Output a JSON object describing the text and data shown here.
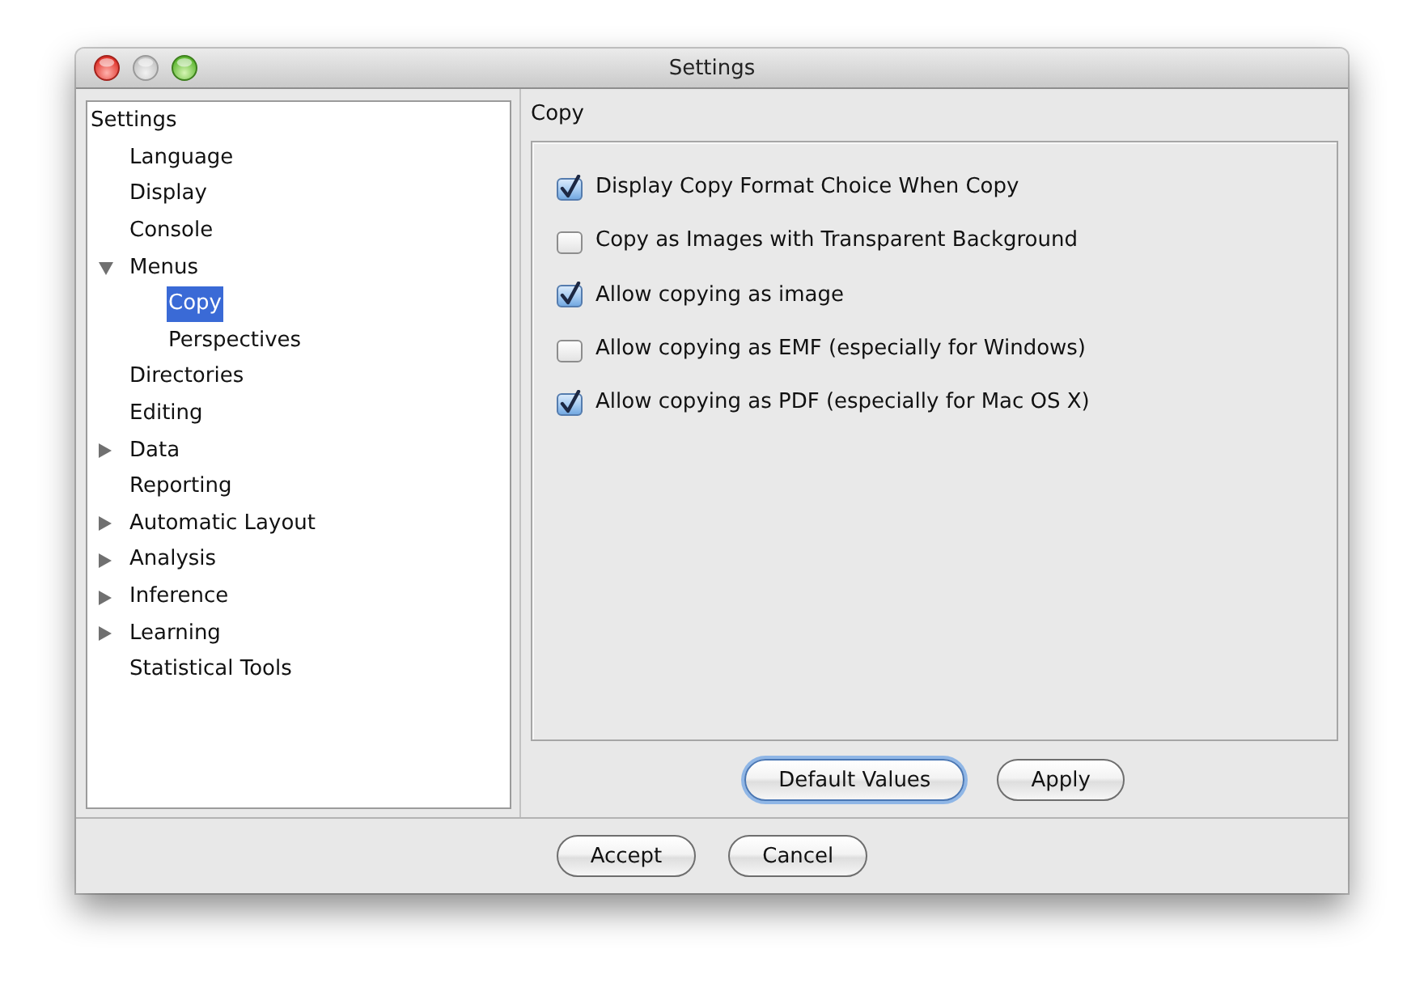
{
  "window": {
    "title": "Settings",
    "controls": [
      {
        "kind": "close",
        "disabled": false
      },
      {
        "kind": "minimize",
        "disabled": true
      },
      {
        "kind": "zoom",
        "disabled": false
      }
    ]
  },
  "tree": {
    "label": "Settings",
    "kind": "root",
    "selected": false,
    "children": [
      {
        "label": "Language",
        "kind": "leaf",
        "selected": false
      },
      {
        "label": "Display",
        "kind": "leaf",
        "selected": false
      },
      {
        "label": "Console",
        "kind": "leaf",
        "selected": false
      },
      {
        "label": "Menus",
        "kind": "branch",
        "selected": false,
        "expanded": true,
        "children": [
          {
            "label": "Copy",
            "kind": "leaf",
            "selected": true
          },
          {
            "label": "Perspectives",
            "kind": "leaf",
            "selected": false
          }
        ]
      },
      {
        "label": "Directories",
        "kind": "leaf",
        "selected": false
      },
      {
        "label": "Editing",
        "kind": "leaf",
        "selected": false
      },
      {
        "label": "Data",
        "kind": "branch",
        "selected": false,
        "expanded": false
      },
      {
        "label": "Reporting",
        "kind": "leaf",
        "selected": false
      },
      {
        "label": "Automatic Layout",
        "kind": "branch",
        "selected": false,
        "expanded": false
      },
      {
        "label": "Analysis",
        "kind": "branch",
        "selected": false,
        "expanded": false
      },
      {
        "label": "Inference",
        "kind": "branch",
        "selected": false,
        "expanded": false
      },
      {
        "label": "Learning",
        "kind": "branch",
        "selected": false,
        "expanded": false
      },
      {
        "label": "Statistical Tools",
        "kind": "leaf",
        "selected": false
      }
    ]
  },
  "panel": {
    "title": "Copy",
    "options": [
      {
        "label": "Display Copy Format Choice When Copy",
        "checked": true
      },
      {
        "label": "Copy as Images with Transparent Background",
        "checked": false
      },
      {
        "label": "Allow copying as image",
        "checked": true
      },
      {
        "label": "Allow copying as EMF (especially for Windows)",
        "checked": false
      },
      {
        "label": "Allow copying as PDF (especially for Mac OS X)",
        "checked": true
      }
    ],
    "buttons": [
      {
        "label": "Default Values",
        "focused": true
      },
      {
        "label": "Apply",
        "focused": false
      }
    ]
  },
  "footer": {
    "buttons": [
      {
        "label": "Accept",
        "focused": false
      },
      {
        "label": "Cancel",
        "focused": false
      }
    ]
  }
}
